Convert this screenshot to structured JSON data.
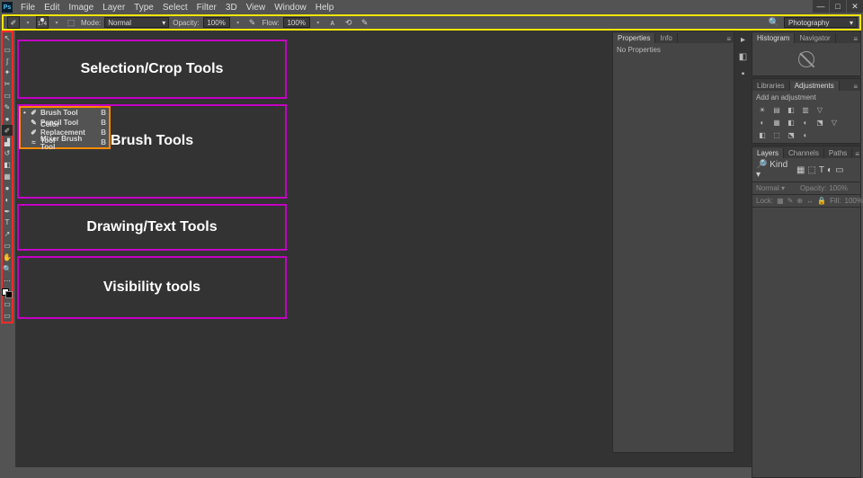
{
  "menu": {
    "items": [
      "File",
      "Edit",
      "Image",
      "Layer",
      "Type",
      "Select",
      "Filter",
      "3D",
      "View",
      "Window",
      "Help"
    ],
    "logo": "Ps"
  },
  "window_controls": {
    "min": "—",
    "max": "□",
    "close": "✕"
  },
  "options": {
    "brush_icon": "✐",
    "brush_dd": "▾",
    "size_label": "174",
    "size_dd": "▾",
    "toggle_icon": "⬚",
    "mode_label": "Mode:",
    "mode_value": "Normal",
    "mode_dd": "▾",
    "opacity_label": "Opacity:",
    "opacity_value": "100%",
    "opacity_dd": "▾",
    "tablet1": "✎",
    "flow_label": "Flow:",
    "flow_value": "100%",
    "flow_dd": "▾",
    "airbrush": "ᴀ",
    "smoothing": "⟲",
    "settings": "✎"
  },
  "workspace": {
    "search": "🔍",
    "value": "Photography",
    "dd": "▾"
  },
  "tools": [
    {
      "name": "move-tool",
      "glyph": "↖"
    },
    {
      "name": "marquee-tool",
      "glyph": "▭"
    },
    {
      "name": "lasso-tool",
      "glyph": "ʃ"
    },
    {
      "name": "quick-select-tool",
      "glyph": "✦"
    },
    {
      "name": "crop-tool",
      "glyph": "✂"
    },
    {
      "name": "frame-tool",
      "glyph": "▭"
    },
    {
      "name": "eyedropper-tool",
      "glyph": "✎"
    },
    {
      "name": "healing-brush-tool",
      "glyph": "●"
    },
    {
      "name": "brush-tool",
      "glyph": "✐",
      "selected": true
    },
    {
      "name": "clone-stamp-tool",
      "glyph": "▟"
    },
    {
      "name": "history-brush-tool",
      "glyph": "↺"
    },
    {
      "name": "eraser-tool",
      "glyph": "◧"
    },
    {
      "name": "gradient-tool",
      "glyph": "▦"
    },
    {
      "name": "blur-tool",
      "glyph": "●"
    },
    {
      "name": "dodge-tool",
      "glyph": "◐"
    },
    {
      "name": "pen-tool",
      "glyph": "✒"
    },
    {
      "name": "type-tool",
      "glyph": "T"
    },
    {
      "name": "path-select-tool",
      "glyph": "↗"
    },
    {
      "name": "rectangle-tool",
      "glyph": "▭"
    },
    {
      "name": "hand-tool",
      "glyph": "✋"
    },
    {
      "name": "zoom-tool",
      "glyph": "🔍"
    },
    {
      "name": "edit-toolbar",
      "glyph": "⋯"
    }
  ],
  "annotations": {
    "selection": "Selection/Crop Tools",
    "brush": "Brush Tools",
    "drawing": "Drawing/Text Tools",
    "visibility": "Visibility tools"
  },
  "flyout": {
    "items": [
      {
        "icon": "✐",
        "name": "Brush Tool",
        "key": "B",
        "sel": true
      },
      {
        "icon": "✎",
        "name": "Pencil Tool",
        "key": "B"
      },
      {
        "icon": "✐",
        "name": "Color Replacement Tool",
        "key": "B"
      },
      {
        "icon": "≈",
        "name": "Mixer Brush Tool",
        "key": "B"
      }
    ]
  },
  "panels": {
    "properties": {
      "tabs": [
        "Properties",
        "Info"
      ],
      "active": 0,
      "body": "No Properties"
    },
    "histogram": {
      "tabs": [
        "Histogram",
        "Navigator"
      ],
      "active": 0
    },
    "libraries": {
      "tabs": [
        "Libraries",
        "Adjustments"
      ],
      "active": 1,
      "header": "Add an adjustment",
      "icons": [
        "☀",
        "▤",
        "◧",
        "▥",
        "▽",
        "",
        "",
        "",
        "◐",
        "▦",
        "◧",
        "◐",
        "⬔",
        "▽",
        "",
        "",
        "◧",
        "⬚",
        "⬔",
        "◐",
        "",
        "",
        "",
        ""
      ]
    },
    "layers": {
      "tabs": [
        "Layers",
        "Channels",
        "Paths"
      ],
      "active": 0,
      "filter_label": "🔎 Kind",
      "filter_dd": "▾",
      "filter_icons": [
        "▦",
        "⬚",
        "T",
        "◐",
        "▭"
      ],
      "blend_mode": "Normal",
      "blend_dd": "▾",
      "opacity_label": "Opacity:",
      "opacity_value": "100%",
      "lock_label": "Lock:",
      "lock_icons": [
        "▦",
        "✎",
        "⊕",
        "↔",
        "🔒"
      ],
      "fill_label": "Fill:",
      "fill_value": "100%"
    }
  },
  "sidestrip": {
    "icons": [
      "▸",
      "◧",
      "▪"
    ]
  }
}
